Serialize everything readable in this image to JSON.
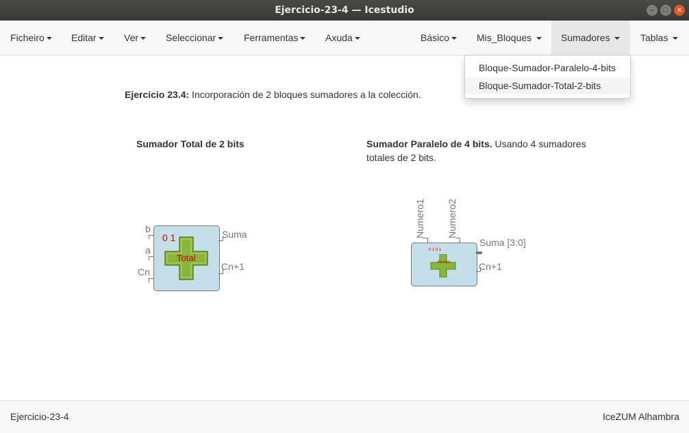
{
  "window": {
    "title": "Ejercicio-23-4 — Icestudio"
  },
  "menubar": {
    "left": [
      "Ficheiro",
      "Editar",
      "Ver",
      "Seleccionar",
      "Ferramentas",
      "Axuda"
    ],
    "right": [
      "Básico",
      "Mis_Bloques",
      "Sumadores",
      "Tablas"
    ]
  },
  "dropdown": {
    "items": [
      "Bloque-Sumador-Paralelo-4-bits",
      "Bloque-Sumador-Total-2-bits"
    ]
  },
  "canvas": {
    "intro_bold": "Ejercicio 23.4:",
    "intro_text": " Incorporación de 2 bloques sumadores a la colección.",
    "total_heading": "Sumador Total de 2 bits",
    "paralelo_heading": "Sumador Paralelo de 4 bits.",
    "paralelo_text_1": " Usando 4 sumadores",
    "paralelo_text_2": "totales de 2 bits.",
    "block_total": {
      "inputs": [
        "b",
        "a",
        "Cn"
      ],
      "outputs": [
        "Suma",
        "Cn+1"
      ],
      "icon_digits": "0 1",
      "icon_label": "Total"
    },
    "block_paralelo": {
      "inputs": [
        "Numero1",
        "Numero2"
      ],
      "outputs": [
        "Suma [3:0]",
        "Cn+1"
      ],
      "icon_digits": "0 1 0 1",
      "icon_label": "Paralelo"
    }
  },
  "statusbar": {
    "left": "Ejercicio-23-4",
    "right": "IceZUM Alhambra"
  },
  "colors": {
    "titlebar": "#3c3b37",
    "close_button": "#e95420",
    "block_fill": "#c4dfea",
    "plus_green": "#8ab43a",
    "icon_red": "#cc0000"
  }
}
